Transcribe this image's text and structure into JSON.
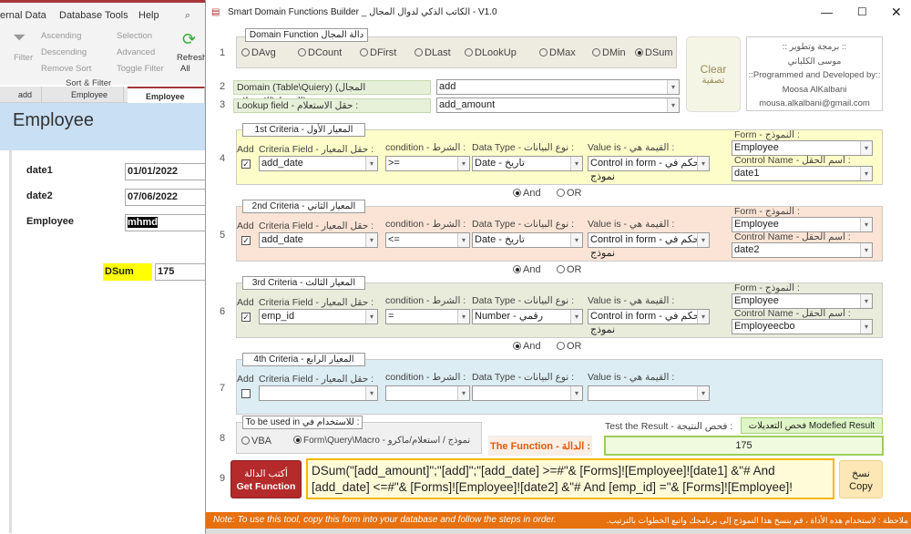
{
  "access": {
    "menu": [
      "ernal Data",
      "Database Tools",
      "Help"
    ],
    "ribbon": {
      "filter": "Filter",
      "ascending": "Ascending",
      "descending": "Descending",
      "remove_sort": "Remove Sort",
      "selection": "Selection",
      "advanced": "Advanced",
      "toggle_filter": "Toggle Filter",
      "group": "Sort & Filter",
      "refresh": "Refresh",
      "refresh_all": "All"
    },
    "tabs": [
      "add",
      "Employee",
      "Employee"
    ],
    "form_title": "Employee",
    "fields": [
      {
        "label": "date1",
        "value": "01/01/2022"
      },
      {
        "label": "date2",
        "value": "07/06/2022"
      },
      {
        "label": "Employee",
        "value": "mhmd"
      }
    ],
    "dsum_label": "DSum",
    "dsum_value": "175"
  },
  "dialog": {
    "title": "Smart Domain Functions Builder _ الكاتب الذكي لدوال المجال  -  V1.0",
    "domain_function": {
      "legend": "Domain Function  دالة المجال",
      "options": [
        "DAvg",
        "DCount",
        "DFirst",
        "DLast",
        "DLookUp",
        "DMax",
        "DMin",
        "DSum"
      ],
      "selected": "DSum"
    },
    "clear": {
      "en": "Clear",
      "ar": "تصفية"
    },
    "credits": [
      ":: برمجة وتطوير ::",
      "موسى الكلباني",
      "::Programmed and Developed by::",
      "Moosa AlKalbani",
      "mousa.alkalbani@gmail.com"
    ],
    "domain_label": "Domain (Table\\Quiery) (المجال (الجدول\\الاستعلام :",
    "domain_value": "add",
    "lookup_label": "Lookup field  -  حقل الاستعلام :",
    "lookup_value": "add_amount",
    "headers": {
      "add": "Add",
      "field": "Criteria Field - حقل المعيار :",
      "condition": "condition - الشرط :",
      "type": "Data Type - نوع البيانات :",
      "value": "Value is - القيمة هي :",
      "form": "Form  -  النموذج :",
      "control": "Control Name  -  اسم الحقل :"
    },
    "criteria": [
      {
        "legend": "1st Criteria - المعيار الأول",
        "checked": true,
        "field": "add_date",
        "condition": ">=",
        "type": "Date - تاريخ",
        "value": "Control in form - حكم في نموذج",
        "form": "Employee",
        "control": "date1",
        "bg": "#fdfdc9"
      },
      {
        "legend": "2nd Criteria - المعيار الثاني",
        "checked": true,
        "field": "add_date",
        "condition": "<=",
        "type": "Date - تاريخ",
        "value": "Control in form - حكم في نموذج",
        "form": "Employee",
        "control": "date2",
        "bg": "#fbe4d5"
      },
      {
        "legend": "3rd Criteria - المعيار الثالث",
        "checked": true,
        "field": "emp_id",
        "condition": "=",
        "type": "Number - رقمي",
        "value": "Control in form - حكم في نموذج",
        "form": "Employee",
        "control": "Employeecbo",
        "bg": "#e9ebdb"
      },
      {
        "legend": "4th Criteria - المعيار الرابع",
        "checked": false,
        "field": "",
        "condition": "",
        "type": "",
        "value": "",
        "bg": "#dcedf3"
      }
    ],
    "andor": {
      "and": "And",
      "or": "OR",
      "selected": "And"
    },
    "used_in": {
      "legend": "To be used in  للاستخدام في :",
      "vba": "VBA",
      "form": "Form\\Query\\Macro - نموذج / استعلام/ماكرو",
      "selected": "form"
    },
    "function_label": "The Function - الدالة :",
    "test_label": "Test the Result - فحص النتيجة  :",
    "modified_btn": "فحص التعديلات Modefied Result",
    "result": "175",
    "get_function": {
      "ar": "أكتب الدالة",
      "en": "Get Function"
    },
    "function_text": "DSum(\"[add_amount]\";\"[add]\";\"[add_date] >=#\"& [Forms]![Employee]![date1] &\"# And [add_date] <=#\"& [Forms]![Employee]![date2] &\"#  And [emp_id] =\"& [Forms]![Employee]![Employeecbo] &\"\")",
    "copy": {
      "ar": "نسخ",
      "en": "Copy"
    },
    "note_en": "Note: To use this tool, copy this form into your database and follow the steps in order.",
    "note_ar": "ملاحظة : لاستخدام هذه الأداة ، قم بنسخ هذا النموذج إلى برنامجك واتبع الخطوات بالترتيب."
  }
}
